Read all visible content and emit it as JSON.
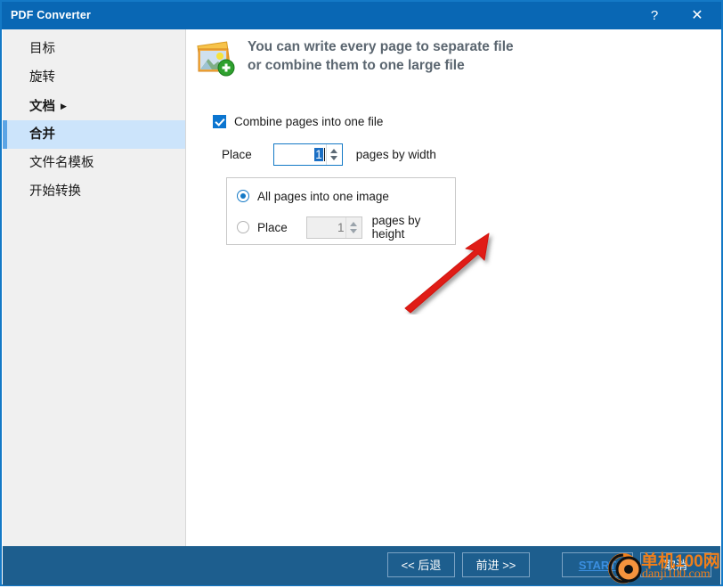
{
  "window": {
    "title": "PDF Converter",
    "help_icon": "?",
    "close_icon": "✕",
    "accent_color": "#0967b4",
    "footer_color": "#1d5e8e"
  },
  "sidebar": {
    "items": [
      {
        "label": "目标",
        "state": "normal"
      },
      {
        "label": "旋转",
        "state": "normal"
      },
      {
        "label": "文档",
        "state": "bold",
        "arrow": "▶"
      },
      {
        "label": "合并",
        "state": "selected"
      },
      {
        "label": "文件名模板",
        "state": "normal"
      },
      {
        "label": "开始转换",
        "state": "normal"
      }
    ],
    "selected_bg": "#cce4fb",
    "accent_bar": "#5ba4e5"
  },
  "main": {
    "header": {
      "icon": "images-add-icon",
      "line1": "You can write every page to separate file",
      "line2": "or combine them to one large file",
      "text_color": "#5b6670"
    },
    "combine_checkbox": {
      "label": "Combine pages into one file",
      "checked": true
    },
    "width_setting": {
      "prefix": "Place",
      "value": "1",
      "suffix": "pages by width",
      "selected": true,
      "enabled": true
    },
    "group": {
      "radio_all": {
        "label": "All pages into one image",
        "selected": true
      },
      "radio_place": {
        "prefix": "Place",
        "value": "1",
        "suffix": "pages by height",
        "selected": false,
        "enabled": false
      }
    },
    "annotation": {
      "type": "red-arrow",
      "color": "#e01b15",
      "points_to": "height-spinner"
    }
  },
  "footer": {
    "buttons": [
      {
        "name": "back",
        "label": "<< 后退"
      },
      {
        "name": "next",
        "label": "前进 >>"
      },
      {
        "name": "start",
        "label": "START"
      },
      {
        "name": "cancel",
        "label": "取消"
      }
    ]
  },
  "watermark": {
    "cn": "单机100网",
    "url": "danji100.com",
    "color": "#f07f1a"
  }
}
